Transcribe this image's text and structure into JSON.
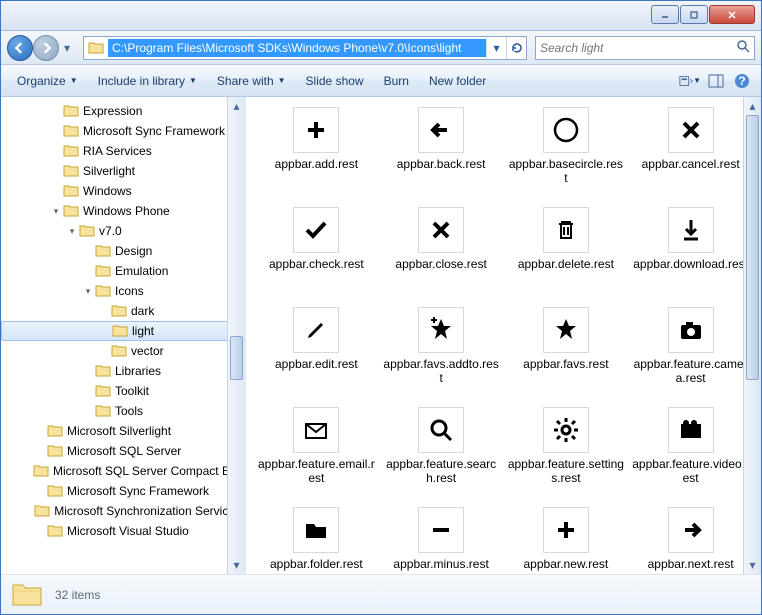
{
  "titlebar": {
    "minimize": "Minimize",
    "maximize": "Maximize",
    "close": "Close"
  },
  "nav": {
    "path": "C:\\Program Files\\Microsoft SDKs\\Windows Phone\\v7.0\\Icons\\light",
    "search_placeholder": "Search light"
  },
  "toolbar": {
    "organize": "Organize",
    "include": "Include in library",
    "share": "Share with",
    "slideshow": "Slide show",
    "burn": "Burn",
    "newfolder": "New folder"
  },
  "tree": [
    {
      "d": 3,
      "exp": "",
      "lbl": "Expression"
    },
    {
      "d": 3,
      "exp": "",
      "lbl": "Microsoft Sync Framework"
    },
    {
      "d": 3,
      "exp": "",
      "lbl": "RIA Services"
    },
    {
      "d": 3,
      "exp": "",
      "lbl": "Silverlight"
    },
    {
      "d": 3,
      "exp": "",
      "lbl": "Windows"
    },
    {
      "d": 3,
      "exp": "open",
      "lbl": "Windows Phone"
    },
    {
      "d": 4,
      "exp": "open",
      "lbl": "v7.0"
    },
    {
      "d": 5,
      "exp": "",
      "lbl": "Design"
    },
    {
      "d": 5,
      "exp": "",
      "lbl": "Emulation"
    },
    {
      "d": 5,
      "exp": "open",
      "lbl": "Icons"
    },
    {
      "d": 6,
      "exp": "",
      "lbl": "dark"
    },
    {
      "d": 6,
      "exp": "",
      "lbl": "light",
      "sel": true
    },
    {
      "d": 6,
      "exp": "",
      "lbl": "vector"
    },
    {
      "d": 5,
      "exp": "",
      "lbl": "Libraries"
    },
    {
      "d": 5,
      "exp": "",
      "lbl": "Toolkit"
    },
    {
      "d": 5,
      "exp": "",
      "lbl": "Tools"
    },
    {
      "d": 2,
      "exp": "",
      "lbl": "Microsoft Silverlight"
    },
    {
      "d": 2,
      "exp": "",
      "lbl": "Microsoft SQL Server"
    },
    {
      "d": 2,
      "exp": "",
      "lbl": "Microsoft SQL Server Compact Edition"
    },
    {
      "d": 2,
      "exp": "",
      "lbl": "Microsoft Sync Framework"
    },
    {
      "d": 2,
      "exp": "",
      "lbl": "Microsoft Synchronization Services"
    },
    {
      "d": 2,
      "exp": "",
      "lbl": "Microsoft Visual Studio"
    }
  ],
  "items": [
    {
      "name": "appbar.add.rest",
      "icon": "plus"
    },
    {
      "name": "appbar.back.rest",
      "icon": "arrow-left"
    },
    {
      "name": "appbar.basecircle.rest",
      "icon": "circle"
    },
    {
      "name": "appbar.cancel.rest",
      "icon": "x"
    },
    {
      "name": "appbar.check.rest",
      "icon": "check"
    },
    {
      "name": "appbar.close.rest",
      "icon": "x"
    },
    {
      "name": "appbar.delete.rest",
      "icon": "trash"
    },
    {
      "name": "appbar.download.rest",
      "icon": "download"
    },
    {
      "name": "appbar.edit.rest",
      "icon": "pencil"
    },
    {
      "name": "appbar.favs.addto.rest",
      "icon": "star-plus"
    },
    {
      "name": "appbar.favs.rest",
      "icon": "star"
    },
    {
      "name": "appbar.feature.camera.rest",
      "icon": "camera"
    },
    {
      "name": "appbar.feature.email.rest",
      "icon": "mail"
    },
    {
      "name": "appbar.feature.search.rest",
      "icon": "search"
    },
    {
      "name": "appbar.feature.settings.rest",
      "icon": "gear"
    },
    {
      "name": "appbar.feature.video.rest",
      "icon": "video"
    },
    {
      "name": "appbar.folder.rest",
      "icon": "folder"
    },
    {
      "name": "appbar.minus.rest",
      "icon": "minus"
    },
    {
      "name": "appbar.new.rest",
      "icon": "plus"
    },
    {
      "name": "appbar.next.rest",
      "icon": "arrow-right"
    }
  ],
  "status": {
    "count": "32 items"
  }
}
